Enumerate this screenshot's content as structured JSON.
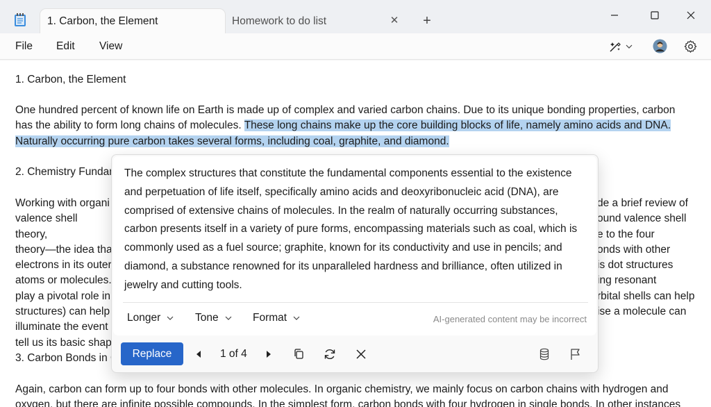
{
  "tabs": [
    {
      "label": "1. Carbon, the Element"
    },
    {
      "label": "Homework to do list"
    }
  ],
  "menu": {
    "file": "File",
    "edit": "Edit",
    "view": "View"
  },
  "document": {
    "heading1": "1. Carbon, the Element",
    "para1_plain": "One hundred percent of known life on Earth is made up of complex and varied carbon chains. Due to its unique bonding properties, carbon\nhas the ability to form long chains of molecules. ",
    "para1_selected_a": "These long chains make up the core building blocks of life, namely amino acids and DNA.",
    "para1_selected_b": "Naturally occurring pure carbon takes several forms, including coal, graphite, and diamond.",
    "heading2": "2. Chemistry Fundan",
    "para2_left": "Working with organi\nvalence shell theory,\ntheory—the idea tha\nelectrons in its outer\natoms or molecules.\nplay a pivotal role in\nstructures) can help\nilluminate the event\ntell us its basic shap",
    "para2_right": "de a brief review of\nound valence shell\ne to the four\nonds with other\nis dot structures\ning resonant\nrbital shells can help\nise a molecule can",
    "heading3": "3. Carbon Bonds in C",
    "para3": "Again, carbon can form up to four bonds with other molecules. In organic chemistry, we mainly focus on carbon chains with hydrogen and\noxygen, but there are infinite possible compounds. In the simplest form, carbon bonds with four hydrogen in single bonds. In other instances"
  },
  "rewrite": {
    "text": "The complex structures that constitute the fundamental components essential to the existence and perpetuation of life itself, specifically amino acids and deoxyribonucleic acid (DNA), are comprised of extensive chains of molecules. In the realm of naturally occurring substances, carbon presents itself in a variety of pure forms, encompassing materials such as coal, which is commonly used as a fuel source; graphite, known for its conductivity and use in pencils; and diamond, a substance renowned for its unparalleled hardness and brilliance, often utilized in jewelry and cutting tools.",
    "options": {
      "longer": "Longer",
      "tone": "Tone",
      "format": "Format"
    },
    "disclaimer": "AI-generated content may be incorrect",
    "replace_label": "Replace",
    "pager": "1 of 4"
  },
  "colors": {
    "accent": "#2766c9",
    "selection": "#b4d3f0"
  },
  "icons": [
    "notepad-icon",
    "close-tab-icon",
    "add-tab-icon",
    "minimize-icon",
    "maximize-icon",
    "close-window-icon",
    "copilot-icon",
    "chevron-down-icon",
    "avatar",
    "gear-icon",
    "previous-icon",
    "next-icon",
    "copy-icon",
    "regenerate-icon",
    "dismiss-icon",
    "database-icon",
    "flag-icon"
  ]
}
